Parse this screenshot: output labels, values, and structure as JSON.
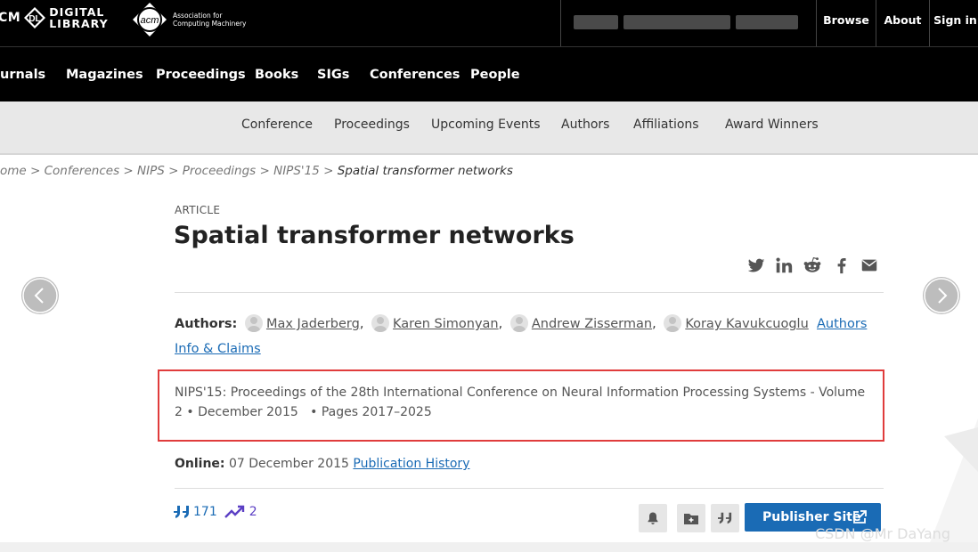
{
  "topbar": {
    "logo_acm_text": "CM",
    "logo_dl_badge": "DL",
    "logo_dl_text_line1": "DIGITAL",
    "logo_dl_text_line2": "LIBRARY",
    "acm_logo_text": "acm",
    "acm_name_line1": "Association for",
    "acm_name_line2": "Computing Machinery",
    "links": [
      "Browse",
      "About",
      "Sign in"
    ]
  },
  "mainnav": [
    "urnals",
    "Magazines",
    "Proceedings",
    "Books",
    "SIGs",
    "Conferences",
    "People"
  ],
  "subnav": [
    "Conference",
    "Proceedings",
    "Upcoming Events",
    "Authors",
    "Affiliations",
    "Award Winners"
  ],
  "breadcrumb": {
    "items": [
      "ome",
      "Conferences",
      "NIPS",
      "Proceedings",
      "NIPS'15"
    ],
    "separator": ">",
    "current": "Spatial transformer networks"
  },
  "article": {
    "type": "ARTICLE",
    "title": "Spatial transformer networks",
    "share_icons": [
      "twitter-icon",
      "linkedin-icon",
      "reddit-icon",
      "facebook-icon",
      "email-icon"
    ],
    "authors_label": "Authors:",
    "authors": [
      "Max Jaderberg",
      "Karen Simonyan",
      "Andrew Zisserman",
      "Koray Kavukcuoglu"
    ],
    "authors_info_link": "Authors Info & Claims",
    "venue": "NIPS'15: Proceedings of the 28th International Conference on Neural Information Processing Systems - Volume 2",
    "date": "December 2015",
    "pages": "Pages 2017–2025",
    "online_label": "Online:",
    "online_date": "07 December 2015",
    "publication_history": "Publication History",
    "citations": "171",
    "downloads": "2",
    "publisher_button": "Publisher Site"
  },
  "colors": {
    "accent": "#1a6bb5",
    "highlight_box": "#e03c3c",
    "downloads": "#5b3fc4"
  },
  "watermark": "CSDN @Mr DaYang"
}
